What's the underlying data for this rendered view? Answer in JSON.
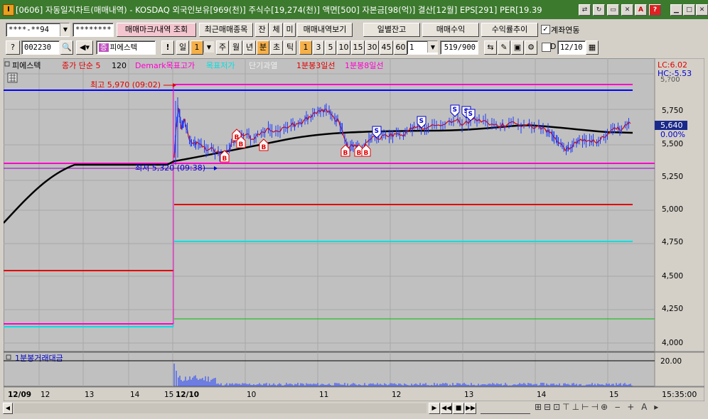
{
  "window": {
    "title": "[0606] 자동일지차트(매매내역) - KOSDAQ 외국인보유[969(천)] 주식수[19,274(천)] 액면[500] 자본금[98(억)] 결산[12월] EPS[291] PER[19.39",
    "app_icon": "I"
  },
  "toolbar1": {
    "account": "****-**94",
    "password": "********",
    "mark_btn": "매매마크/내역 조회",
    "recent_btn": "최근매매종목",
    "tab_jan": "잔",
    "tab_che": "체",
    "tab_mi": "미",
    "view_history_btn": "매매내역보기",
    "daily_balance_btn": "일별잔고",
    "trade_profit_btn": "매매수익",
    "yield_trend_btn": "수익률추이",
    "account_link_label": "계좌연동",
    "account_link_checked": true
  },
  "toolbar2": {
    "code": "002230",
    "stock_name": "피에스텍",
    "excl": "!",
    "period_day": "일",
    "period_value": "1",
    "periods": [
      "주",
      "월",
      "년",
      "분",
      "초",
      "틱"
    ],
    "minute_values": [
      "1",
      "3",
      "5",
      "10",
      "15",
      "30",
      "45",
      "60"
    ],
    "custom_interval": "1",
    "bar_count": "519/900",
    "date_value": "12/10"
  },
  "legend": {
    "name": "피에스텍",
    "ma": "종가 단순 5",
    "ma_n": "120",
    "demark": "Demark목표고가",
    "target": "목표저가",
    "short": "단기과열",
    "ma3": "1분봉3일선",
    "ma8": "1분봉8일선"
  },
  "right_labels": {
    "lc": "LC:6.02",
    "hc": "HC:-5.53"
  },
  "annotations": {
    "high": "최고 5,970 (09:02)",
    "low": "최저 5,320 (09:38)"
  },
  "current": {
    "price": "5,640",
    "pct": "0.00%"
  },
  "y_axis": [
    "5,750",
    "5,500",
    "5,250",
    "5,000",
    "4,750",
    "4,500",
    "4,250",
    "4,000"
  ],
  "y_top_partial": "5,?00",
  "volume": {
    "title": "1분봉거래대금",
    "axis_label": "20.00"
  },
  "x_axis": {
    "labels": [
      "12/09",
      "12",
      "13",
      "14",
      "15",
      "12/10",
      "10",
      "11",
      "12",
      "13",
      "14",
      "15"
    ],
    "time": "15:35:00"
  },
  "colors": {
    "title_bg": "#3c7a2e",
    "chart_bg": "#c0c0c0",
    "blue_line": "#0000ff",
    "magenta": "#ff00cc",
    "red": "#e00000",
    "cyan": "#00e0e0",
    "green": "#00c000",
    "purple": "#9900cc",
    "current_box": "#1a2a8a"
  },
  "markers": {
    "buy": "B",
    "sell": "S"
  }
}
